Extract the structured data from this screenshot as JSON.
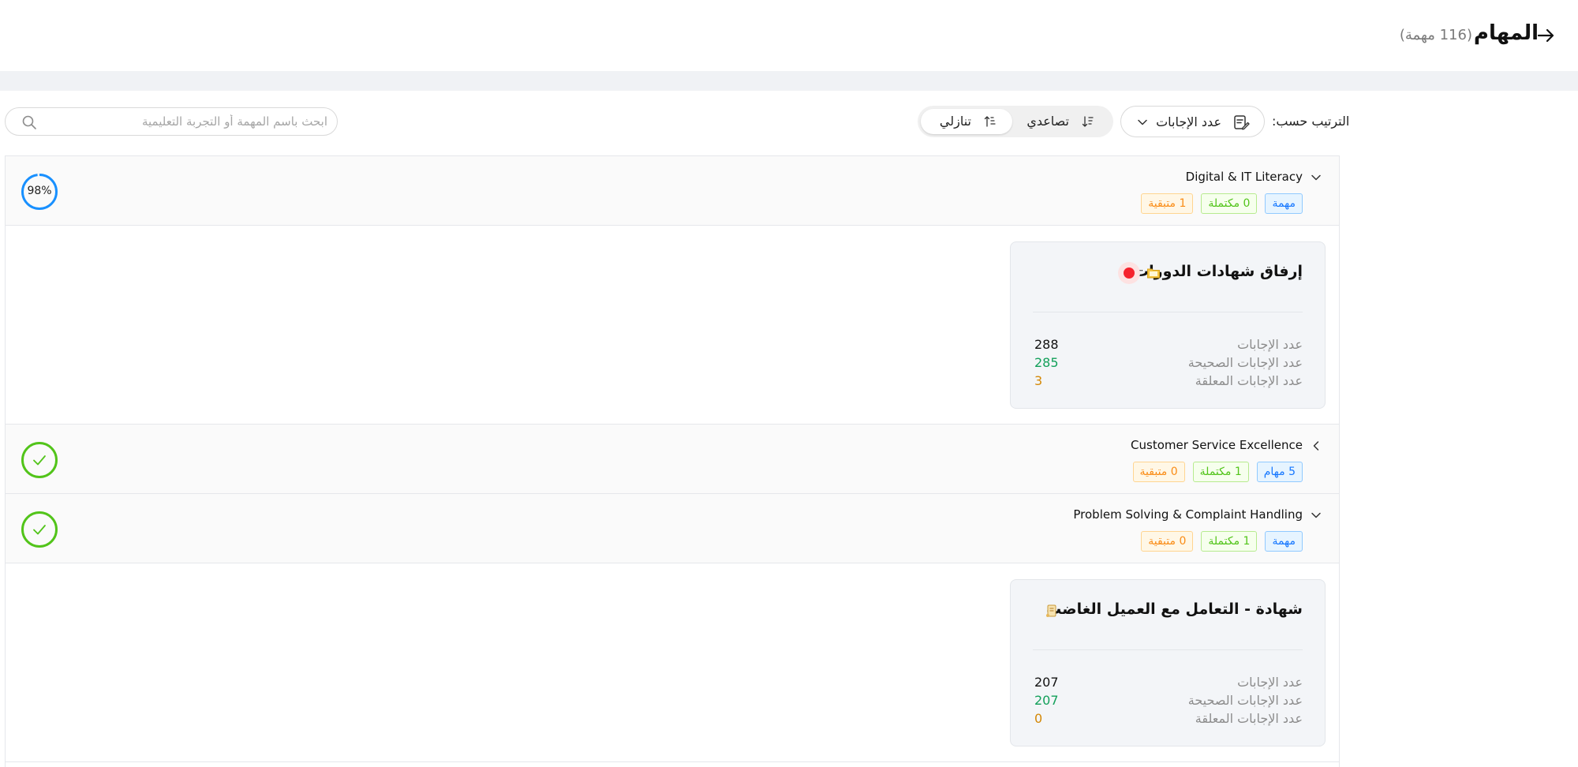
{
  "header": {
    "title": "المهام",
    "task_count": "(116 مهمة)"
  },
  "toolbar": {
    "sort_label": "الترتيب حسب:",
    "sort_selected": "عدد الإجابات",
    "order_asc": "تصاعدي",
    "order_desc": "تنازلي",
    "order_selected": "desc",
    "search_placeholder": "ابحث باسم المهمة أو التجربة التعليمية"
  },
  "groups": [
    {
      "title": "Digital & IT Literacy",
      "expanded": true,
      "tags": {
        "tasks": "مهمة",
        "completed": "0 مكتملة",
        "remaining": "1 متبقية"
      },
      "status": {
        "type": "progress",
        "percent": 98,
        "label": "98%"
      },
      "task": {
        "title": "إرفاق شهادات الدورات",
        "emoji_icon": "folder-icon",
        "has_alert_dot": true,
        "stats": {
          "total_label": "عدد الإجابات",
          "total_value": "288",
          "correct_label": "عدد الإجابات الصحيحة",
          "correct_value": "285",
          "pending_label": "عدد الإجابات المعلقة",
          "pending_value": "3"
        }
      }
    },
    {
      "title": "Customer Service Excellence",
      "expanded": false,
      "tags": {
        "tasks": "5 مهام",
        "completed": "1 مكتملة",
        "remaining": "0 متبقية"
      },
      "status": {
        "type": "complete"
      }
    },
    {
      "title": "Problem Solving & Complaint Handling",
      "expanded": true,
      "tags": {
        "tasks": "مهمة",
        "completed": "1 مكتملة",
        "remaining": "0 متبقية"
      },
      "status": {
        "type": "complete"
      },
      "task": {
        "title": "شهادة - التعامل مع العميل الغاضب",
        "emoji_icon": "scroll-icon",
        "has_alert_dot": false,
        "stats": {
          "total_label": "عدد الإجابات",
          "total_value": "207",
          "correct_label": "عدد الإجابات الصحيحة",
          "correct_value": "207",
          "pending_label": "عدد الإجابات المعلقة",
          "pending_value": "0"
        }
      }
    }
  ],
  "colors": {
    "progress_blue": "#1890ff",
    "complete_green": "#52c41a",
    "alert_red": "#f5222d"
  }
}
